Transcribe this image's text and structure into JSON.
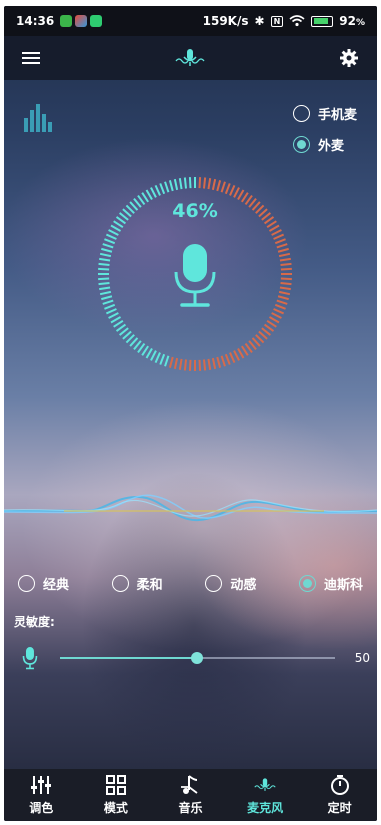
{
  "status_bar": {
    "time": "14:36",
    "network_speed": "159K/s",
    "battery_percent": "92",
    "battery_unit": "%"
  },
  "topbar": {
    "menu_icon": "menu-icon",
    "center_icon": "mic-wave-icon",
    "settings_icon": "gear-icon"
  },
  "mic_source": {
    "options": [
      {
        "label": "手机麦",
        "selected": false
      },
      {
        "label": "外麦",
        "selected": true
      }
    ]
  },
  "level": {
    "percent_text": "46%",
    "value": 0.46,
    "colors": {
      "active": "#5fe6dc",
      "inactive": "#d76a4a"
    }
  },
  "modes": [
    {
      "label": "经典",
      "selected": false
    },
    {
      "label": "柔和",
      "selected": false
    },
    {
      "label": "动感",
      "selected": false
    },
    {
      "label": "迪斯科",
      "selected": true
    }
  ],
  "sensitivity": {
    "label": "灵敏度:",
    "value": 50,
    "max": 100,
    "value_text": "50"
  },
  "bottom_nav": [
    {
      "label": "调色",
      "icon": "sliders-icon",
      "active": false
    },
    {
      "label": "模式",
      "icon": "grid-icon",
      "active": false
    },
    {
      "label": "音乐",
      "icon": "music-icon",
      "active": false
    },
    {
      "label": "麦克风",
      "icon": "mic-wave-icon",
      "active": true
    },
    {
      "label": "定时",
      "icon": "timer-icon",
      "active": false
    }
  ],
  "accent_color": "#5fe6dc"
}
